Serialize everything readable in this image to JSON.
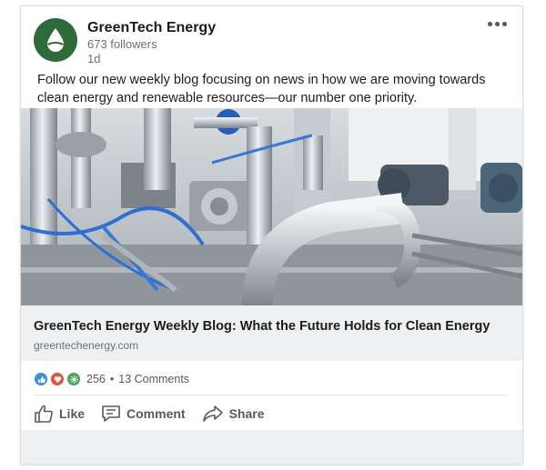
{
  "post": {
    "company_name": "GreenTech Energy",
    "followers": "673 followers",
    "time": "1d",
    "text": "Follow our new weekly blog focusing on news in how we are moving towards clean energy and renewable resources—our number one priority."
  },
  "link": {
    "title": "GreenTech Energy Weekly Blog: What the Future Holds for Clean Energy",
    "domain": "greentechenergy.com"
  },
  "social": {
    "reaction_icons": [
      "like-icon",
      "love-icon",
      "celebrate-icon"
    ],
    "reaction_count": "256",
    "separator": "•",
    "comments": "13 Comments"
  },
  "actions": {
    "like": "Like",
    "comment": "Comment",
    "share": "Share"
  },
  "colors": {
    "brand_green": "#2f6b3a",
    "like_blue": "#3a8fd8",
    "love_red": "#e0523c",
    "celebrate_green": "#4aa35a"
  }
}
